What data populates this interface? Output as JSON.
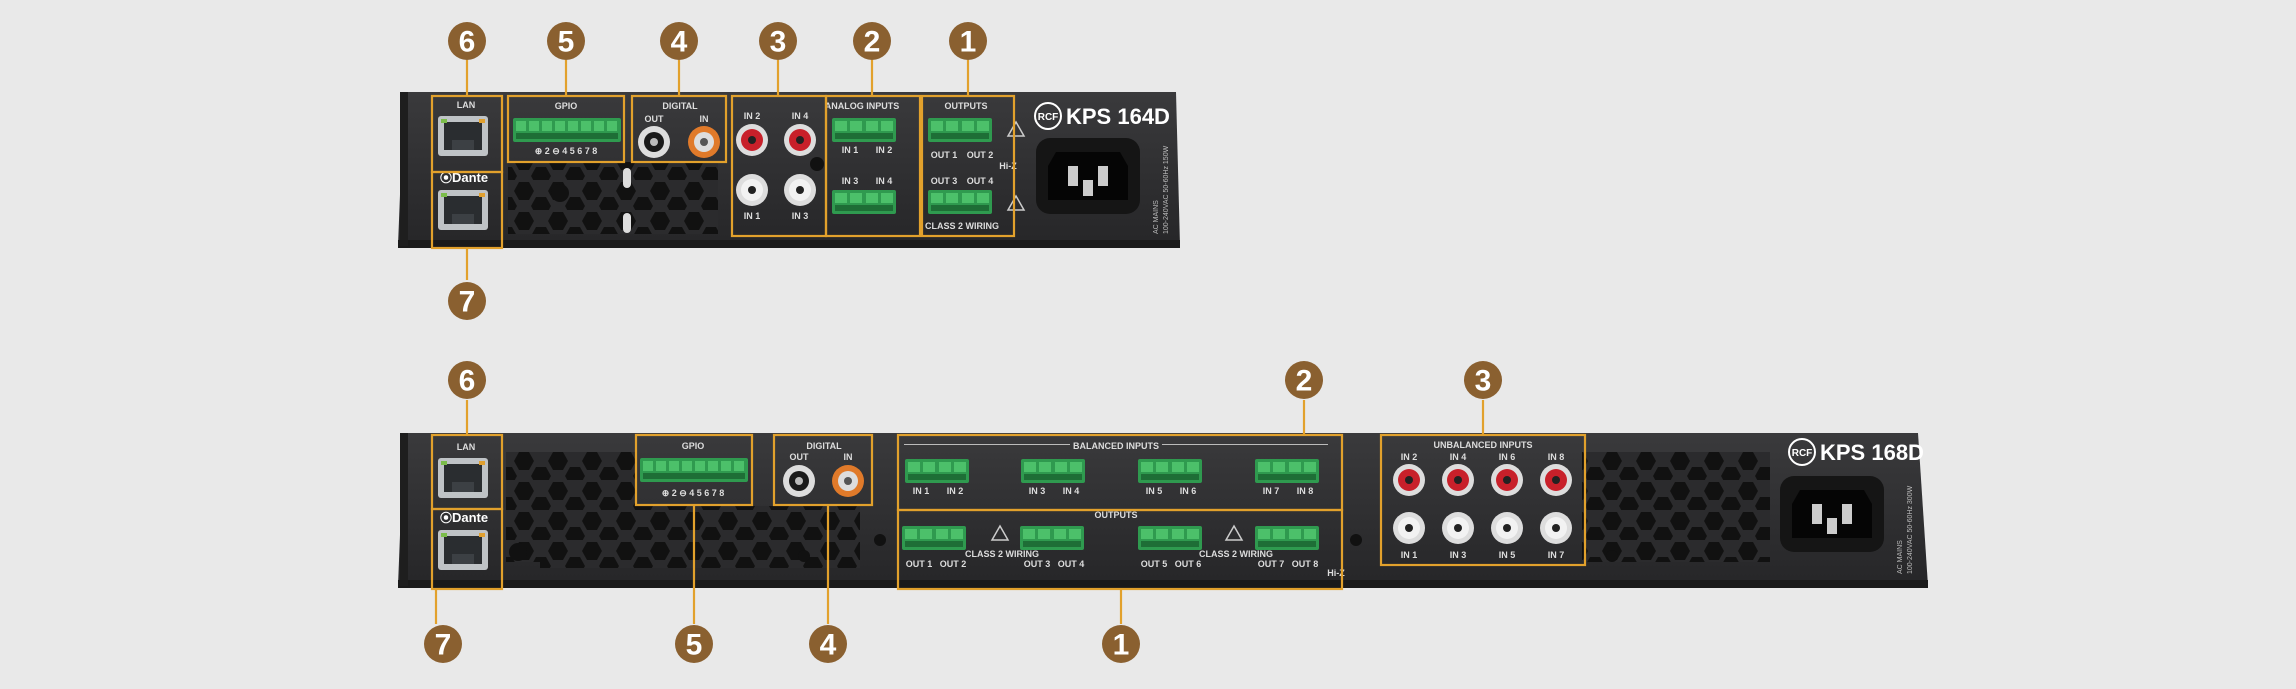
{
  "device1": {
    "model": "KPS 164D",
    "brand": "RCF",
    "labels": {
      "lan": "LAN",
      "gpio": "GPIO",
      "gpio_pins": "⊕ 2 ⊖ 4 5 6 7 8",
      "digital": "DIGITAL",
      "out": "OUT",
      "in": "IN",
      "analog_inputs": "ANALOG INPUTS",
      "in2": "IN 2",
      "in4": "IN 4",
      "in1": "IN 1",
      "in3": "IN 3",
      "in1b": "IN 1",
      "in2b": "IN 2",
      "in3b": "IN 3",
      "in4b": "IN 4",
      "outputs": "OUTPUTS",
      "out1": "OUT 1",
      "out2": "OUT 2",
      "out3": "OUT 3",
      "out4": "OUT 4",
      "class2": "CLASS 2 WIRING",
      "hiz": "Hi-Z",
      "dante": "Dante",
      "ac_mains": "AC MAINS",
      "rating": "100-240VAC 50-60Hz 150W"
    }
  },
  "device2": {
    "model": "KPS 168D",
    "brand": "RCF",
    "labels": {
      "lan": "LAN",
      "gpio": "GPIO",
      "gpio_pins": "⊕ 2 ⊖ 4 5 6 7 8",
      "digital": "DIGITAL",
      "out": "OUT",
      "in": "IN",
      "balanced_inputs": "BALANCED INPUTS",
      "bin1": "IN 1",
      "bin2": "IN 2",
      "bin3": "IN 3",
      "bin4": "IN 4",
      "bin5": "IN 5",
      "bin6": "IN 6",
      "bin7": "IN 7",
      "bin8": "IN 8",
      "outputs": "OUTPUTS",
      "out1": "OUT 1",
      "out2": "OUT 2",
      "out3": "OUT 3",
      "out4": "OUT 4",
      "out5": "OUT 5",
      "out6": "OUT 6",
      "out7": "OUT 7",
      "out8": "OUT 8",
      "class2": "CLASS 2 WIRING",
      "hiz": "Hi-Z",
      "unbalanced_inputs": "UNBALANCED INPUTS",
      "uin2": "IN 2",
      "uin4": "IN 4",
      "uin6": "IN 6",
      "uin8": "IN 8",
      "uin1": "IN 1",
      "uin3": "IN 3",
      "uin5": "IN 5",
      "uin7": "IN 7",
      "dante": "Dante",
      "ac_mains": "AC MAINS",
      "rating": "100-240VAC 50-60Hz 300W"
    }
  },
  "markers": {
    "m1": "1",
    "m2": "2",
    "m3": "3",
    "m4": "4",
    "m5": "5",
    "m6": "6",
    "m7": "7"
  },
  "colors": {
    "marker": "#8a6030",
    "highlight": "#e2a12c",
    "chassis": "#2b2b2d",
    "terminal_green": "#3aa55a",
    "rca_red": "#c8202a",
    "rca_white": "#e8e8e8",
    "rca_orange": "#d9772a"
  }
}
